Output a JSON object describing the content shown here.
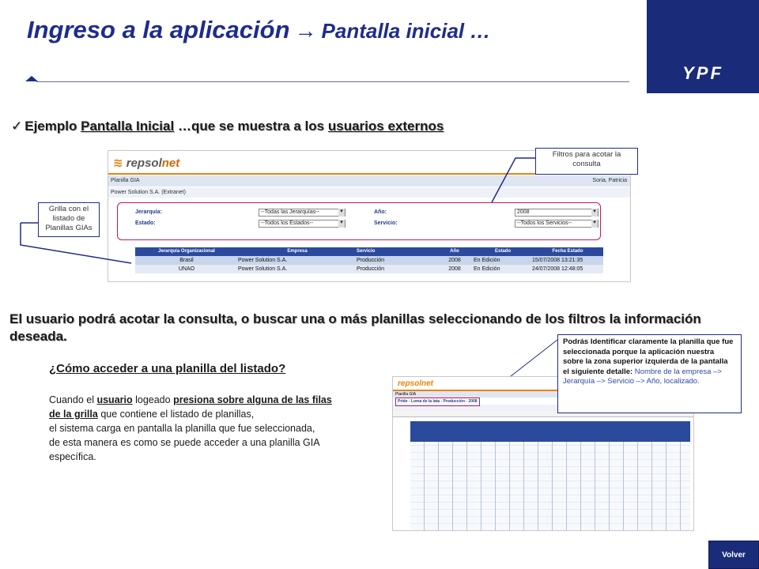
{
  "header": {
    "title_main": "Ingreso a la aplicación",
    "title_arrow": "→",
    "title_sub": "Pantalla inicial …",
    "brand": "YPF"
  },
  "bullet": {
    "check": "✓",
    "part1": "Ejemplo ",
    "part2": "Pantalla Inicial",
    "part3": " …que se muestra a los ",
    "part4": "usuarios externos"
  },
  "screenshot1": {
    "logo_a": "repsol",
    "logo_b": "net",
    "bar1_left": "Planilla GIA",
    "bar1_right": "Soria, Patricia",
    "bar2": "Power Solution S.A. (Extranet)",
    "filters": {
      "jerarquia_label": "Jerarquía:",
      "jerarquia_value": "--Todas las Jerarquías--",
      "estado_label": "Estado:",
      "estado_value": "--Todos los Estados--",
      "anio_label": "Año:",
      "anio_value": "2008",
      "servicio_label": "Servicio:",
      "servicio_value": "--Todos los Servicios--"
    },
    "grid": {
      "headers": [
        "Jerarquía Organizacional",
        "Empresa",
        "Servicio",
        "Año",
        "Estado",
        "Fecha Estado"
      ],
      "rows": [
        [
          "Brasil",
          "Power Solution S.A.",
          "Producción",
          "2008",
          "En Edición",
          "15/07/2008 13:21:35"
        ],
        [
          "UNAO",
          "Power Solution S.A.",
          "Producción",
          "2008",
          "En Edición",
          "24/07/2008 12:48:05"
        ]
      ]
    }
  },
  "callouts": {
    "filtros": "Filtros para acotar la consulta",
    "grilla": "Grilla con el listado de Planillas GIAs",
    "big_bold": "Podrás Identificar claramente la planilla que fue seleccionada porque la aplicación nuestra sobre la zona superior izquierda de la pantalla el siguiente detalle:",
    "big_blue": " Nombre de la empresa –> Jerarquía –> Servicio –> Año, localizado."
  },
  "paragraph": "El usuario podrá acotar la consulta, o buscar una o más planillas seleccionando de los filtros la información deseada.",
  "howto": "¿Cómo acceder a una planilla del listado?",
  "description": {
    "d1": "Cuando el ",
    "d2": "usuario",
    "d3": " logeado ",
    "d4": "presiona sobre alguna de las filas",
    "d5": "de la grilla",
    "d6": " que contiene el listado de planillas,",
    "d7": "el sistema carga en pantalla la planilla que fue seleccionada,",
    "d8": "de esta manera es como se puede acceder a una planilla GIA",
    "d9": "específica."
  },
  "screenshot2": {
    "logo": "repsolnet",
    "bar": "Planilla GIA",
    "breadcrumb": "Pride - Loma de la lata - Producción - 2008"
  },
  "volver": "Volver",
  "colors": {
    "navy": "#1a2b7a",
    "accent_orange": "#e8820c",
    "highlight_pink": "#c2185b"
  }
}
